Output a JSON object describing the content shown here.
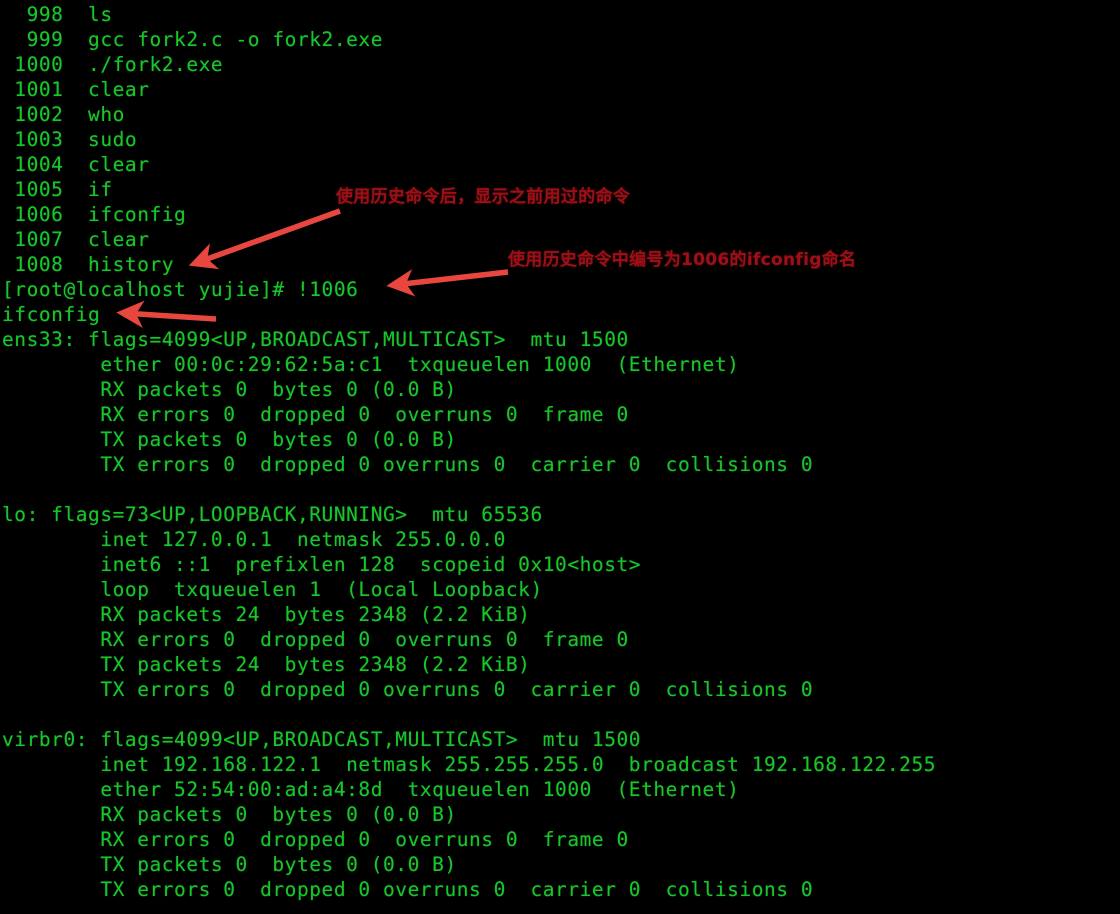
{
  "terminal": {
    "background_color": "#000000",
    "text_color": "#18c62b",
    "annotation_color": "#9d1018",
    "arrow_color": "#e8473f",
    "lines": [
      "  998  ls",
      "  999  gcc fork2.c -o fork2.exe",
      " 1000  ./fork2.exe",
      " 1001  clear",
      " 1002  who",
      " 1003  sudo",
      " 1004  clear",
      " 1005  if",
      " 1006  ifconfig",
      " 1007  clear",
      " 1008  history",
      "[root@localhost yujie]# !1006",
      "ifconfig",
      "ens33: flags=4099<UP,BROADCAST,MULTICAST>  mtu 1500",
      "        ether 00:0c:29:62:5a:c1  txqueuelen 1000  (Ethernet)",
      "        RX packets 0  bytes 0 (0.0 B)",
      "        RX errors 0  dropped 0  overruns 0  frame 0",
      "        TX packets 0  bytes 0 (0.0 B)",
      "        TX errors 0  dropped 0 overruns 0  carrier 0  collisions 0",
      "",
      "lo: flags=73<UP,LOOPBACK,RUNNING>  mtu 65536",
      "        inet 127.0.0.1  netmask 255.0.0.0",
      "        inet6 ::1  prefixlen 128  scopeid 0x10<host>",
      "        loop  txqueuelen 1  (Local Loopback)",
      "        RX packets 24  bytes 2348 (2.2 KiB)",
      "        RX errors 0  dropped 0  overruns 0  frame 0",
      "        TX packets 24  bytes 2348 (2.2 KiB)",
      "        TX errors 0  dropped 0 overruns 0  carrier 0  collisions 0",
      "",
      "virbr0: flags=4099<UP,BROADCAST,MULTICAST>  mtu 1500",
      "        inet 192.168.122.1  netmask 255.255.255.0  broadcast 192.168.122.255",
      "        ether 52:54:00:ad:a4:8d  txqueuelen 1000  (Ethernet)",
      "        RX packets 0  bytes 0 (0.0 B)",
      "        RX errors 0  dropped 0  overruns 0  frame 0",
      "        TX packets 0  bytes 0 (0.0 B)",
      "        TX errors 0  dropped 0 overruns 0  carrier 0  collisions 0"
    ]
  },
  "annotations": {
    "note_history_output": "使用历史命令后，显示之前用过的命令",
    "note_bang_1006": "使用历史命令中编号为1006的ifconfig命名"
  }
}
